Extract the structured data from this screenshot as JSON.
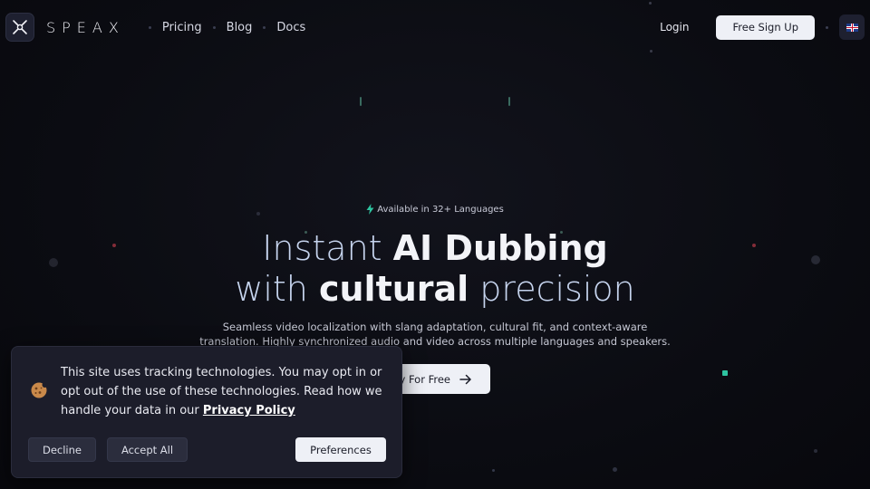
{
  "nav": {
    "brand": "SPEAX",
    "links": [
      "Pricing",
      "Blog",
      "Docs"
    ],
    "login": "Login",
    "signup": "Free Sign Up",
    "language_icon": "uk-flag-icon"
  },
  "hero": {
    "badge": "Available in 32+ Languages",
    "title_line1_light": "Instant ",
    "title_line1_bold": "AI Dubbing",
    "title_line2_light_a": "with ",
    "title_line2_bold": "cultural",
    "title_line2_light_b": " precision",
    "subtitle_line1": "Seamless video localization with slang adaptation, cultural fit, and context-aware",
    "subtitle_line2": "translation. Highly synchronized audio and video across multiple languages and speakers.",
    "cta_visible": "ry For Free"
  },
  "cookie": {
    "text": "This site uses tracking technologies. You may opt in or opt out of the use of these technologies. Read how we handle your data in our ",
    "link": "Privacy Policy",
    "decline": "Decline",
    "accept": "Accept All",
    "preferences": "Preferences"
  },
  "colors": {
    "background": "#0b0c12",
    "accent_green": "#2ec4a0",
    "button_light": "#eef0f6",
    "panel": "#1c1d2a"
  }
}
